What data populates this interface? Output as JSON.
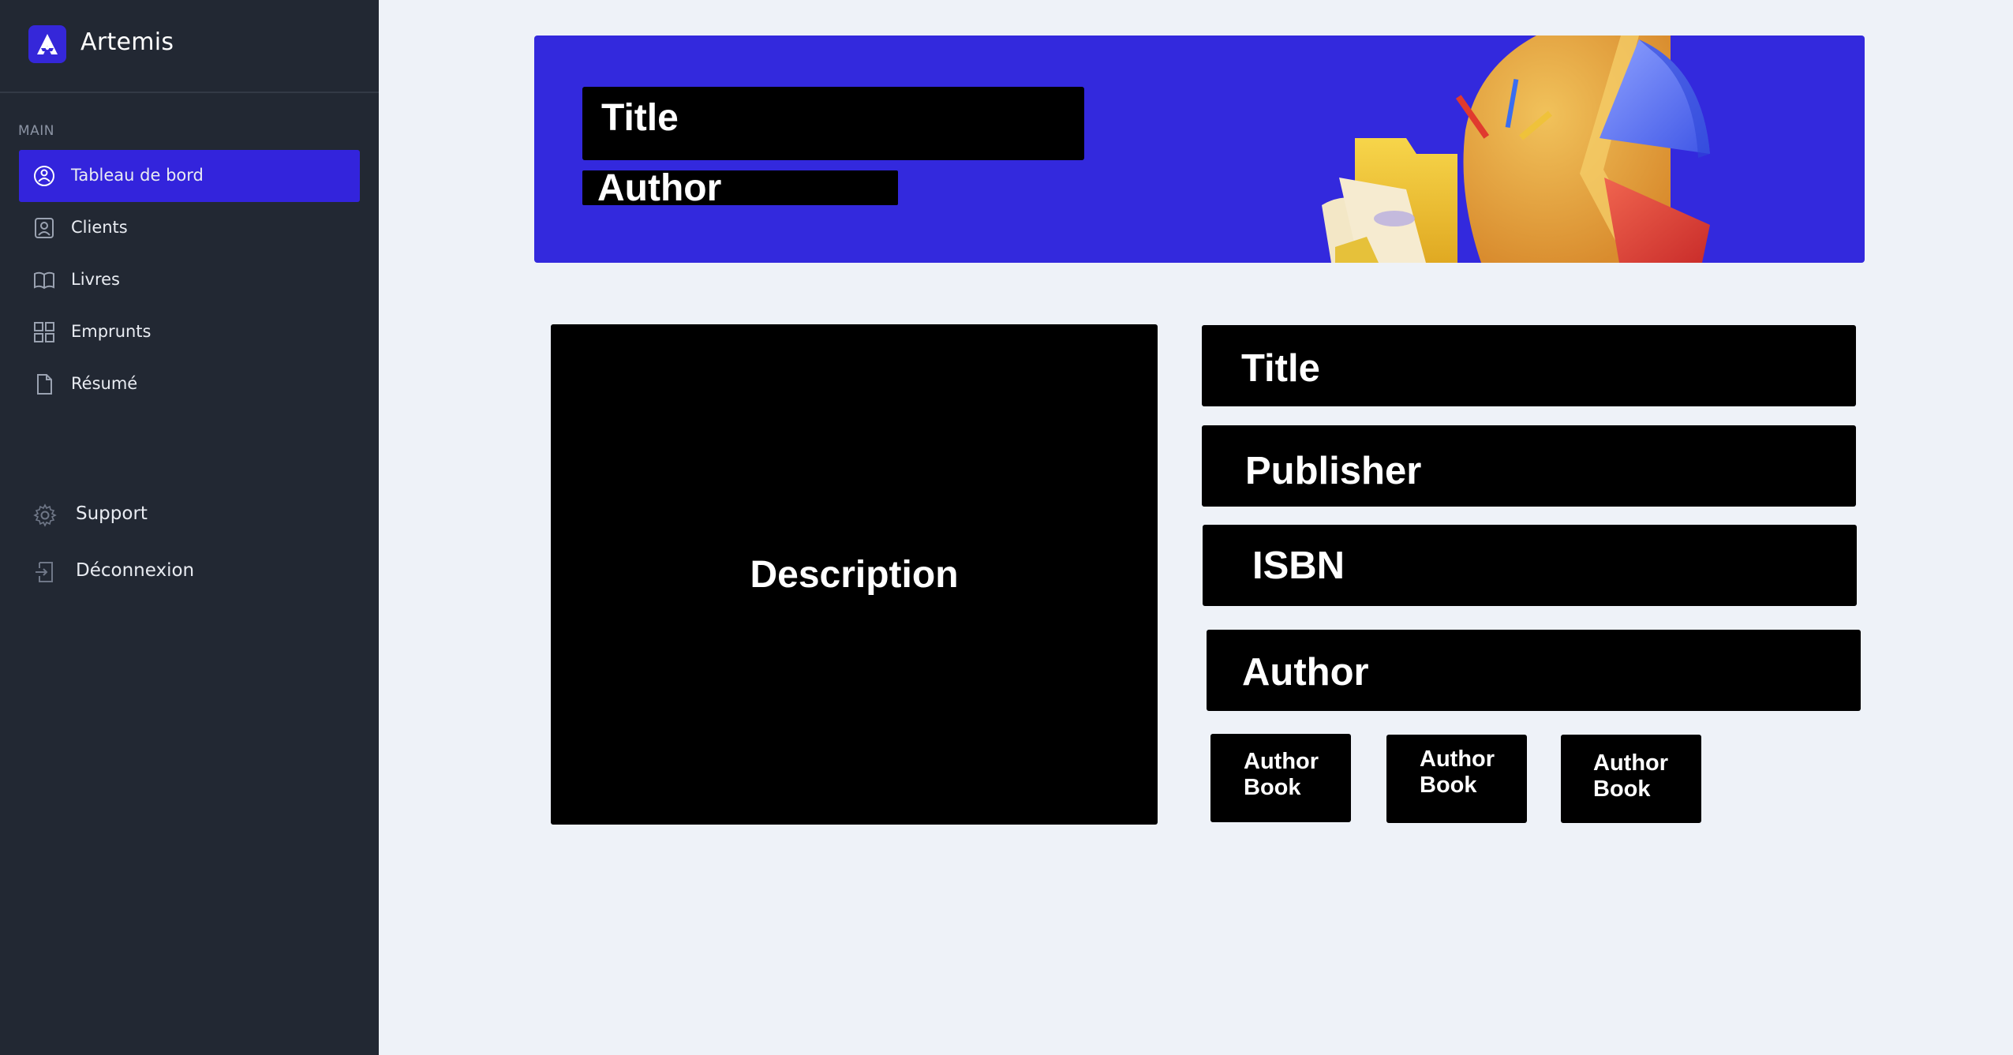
{
  "app": {
    "name": "Artemis"
  },
  "sidebar": {
    "section_label": "MAIN",
    "items": [
      {
        "label": "Tableau de bord",
        "icon": "dashboard-icon",
        "active": true
      },
      {
        "label": "Clients",
        "icon": "user-icon",
        "active": false
      },
      {
        "label": "Livres",
        "icon": "book-icon",
        "active": false
      },
      {
        "label": "Emprunts",
        "icon": "grid-icon",
        "active": false
      },
      {
        "label": "Résumé",
        "icon": "document-icon",
        "active": false
      }
    ],
    "aux_items": [
      {
        "label": "Support",
        "icon": "gear-icon"
      },
      {
        "label": "Déconnexion",
        "icon": "logout-icon"
      }
    ]
  },
  "banner": {
    "title": "Title",
    "author": "Author"
  },
  "details": {
    "description": "Description",
    "title": "Title",
    "publisher": "Publisher",
    "isbn": "ISBN",
    "author": "Author",
    "author_books": [
      {
        "line1": "Author",
        "line2": "Book"
      },
      {
        "line1": "Author",
        "line2": "Book"
      },
      {
        "line1": "Author",
        "line2": "Book"
      }
    ]
  },
  "colors": {
    "accent": "#3324dc",
    "sidebar_bg": "#222833",
    "page_bg": "#eef2f8",
    "block_bg": "#000000"
  }
}
